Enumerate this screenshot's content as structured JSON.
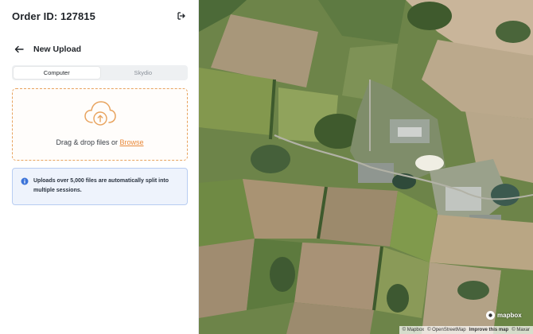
{
  "sidebar": {
    "order_title": "Order ID: 127815",
    "back_title": "New Upload",
    "tabs": [
      {
        "label": "Computer",
        "active": true
      },
      {
        "label": "Skydio",
        "active": false
      }
    ],
    "dropzone": {
      "text": "Drag & drop files or ",
      "browse_label": "Browse"
    },
    "info": {
      "text": "Uploads over 5,000 files are automatically split into multiple sessions."
    }
  },
  "map": {
    "logo_text": "mapbox",
    "attribution": {
      "mapbox": "© Mapbox",
      "osm": "© OpenStreetMap",
      "improve": "Improve this map",
      "maxar": "© Maxar"
    }
  },
  "colors": {
    "accent": "#e8893a",
    "info_bg": "#eef3fc",
    "info_border": "#b8cdf2"
  },
  "icons": {
    "exit": "logout-icon",
    "back": "arrow-left-icon",
    "upload": "cloud-upload-icon",
    "info": "info-icon"
  }
}
